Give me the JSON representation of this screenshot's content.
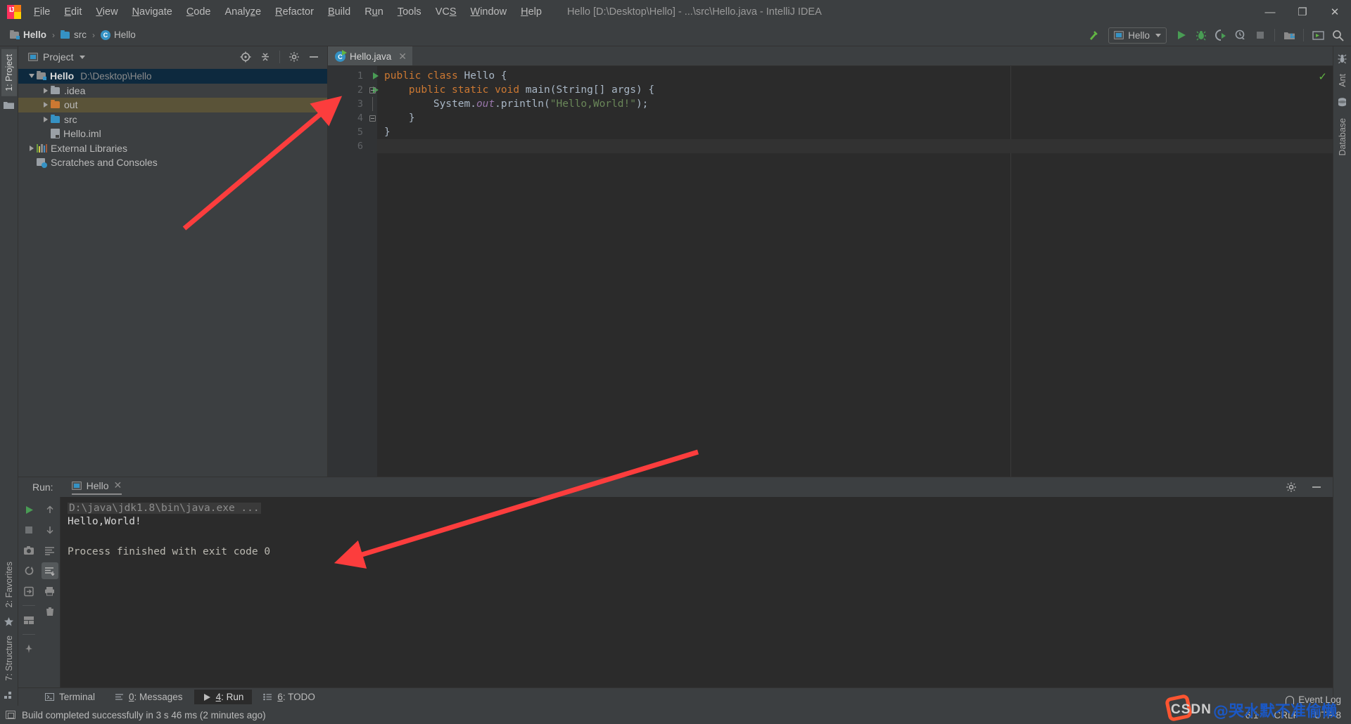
{
  "window": {
    "title": "Hello [D:\\Desktop\\Hello] - ...\\src\\Hello.java - IntelliJ IDEA",
    "minimize": "—",
    "maximize": "❐",
    "close": "✕"
  },
  "menu": [
    {
      "label": "File",
      "mnemonic": "F"
    },
    {
      "label": "Edit",
      "mnemonic": "E"
    },
    {
      "label": "View",
      "mnemonic": "V"
    },
    {
      "label": "Navigate",
      "mnemonic": "N"
    },
    {
      "label": "Code",
      "mnemonic": "C"
    },
    {
      "label": "Analyze",
      "mnemonic": "z"
    },
    {
      "label": "Refactor",
      "mnemonic": "R"
    },
    {
      "label": "Build",
      "mnemonic": "B"
    },
    {
      "label": "Run",
      "mnemonic": "u"
    },
    {
      "label": "Tools",
      "mnemonic": "T"
    },
    {
      "label": "VCS",
      "mnemonic": "S"
    },
    {
      "label": "Window",
      "mnemonic": "W"
    },
    {
      "label": "Help",
      "mnemonic": "H"
    }
  ],
  "breadcrumb": [
    {
      "label": "Hello",
      "icon": "module-icon"
    },
    {
      "label": "src",
      "icon": "folder-icon"
    },
    {
      "label": "Hello",
      "icon": "class-icon"
    }
  ],
  "toolbar": {
    "build_icon": "hammer-icon",
    "run_config": "Hello",
    "run_icon": "run-icon",
    "debug_icon": "debug-icon",
    "coverage_icon": "run-with-coverage-icon",
    "profile_icon": "profiler-icon",
    "stop_icon": "stop-icon",
    "structure_icon": "project-structure-icon",
    "layout_icon": "layout-icon",
    "search_icon": "search-everywhere-icon"
  },
  "left_sidebar": {
    "top": [
      {
        "label": "1: Project",
        "active": true
      }
    ],
    "bottom": [
      {
        "label": "2: Favorites",
        "active": false
      },
      {
        "label": "7: Structure",
        "active": false
      }
    ]
  },
  "right_sidebar": [
    {
      "label": "Ant",
      "icon": "ant-icon"
    },
    {
      "label": "Database",
      "icon": "database-icon"
    }
  ],
  "project_panel": {
    "title": "Project",
    "locate_icon": "locate-icon",
    "collapse_icon": "collapse-all-icon",
    "settings_icon": "gear-icon",
    "hide_icon": "hide-icon",
    "tree": [
      {
        "label": "Hello",
        "path": "D:\\Desktop\\Hello",
        "icon": "module-icon",
        "indent": 0,
        "arrow": "open",
        "state": "selected",
        "bold": true
      },
      {
        "label": ".idea",
        "path": "",
        "icon": "folder-grey-icon",
        "indent": 1,
        "arrow": "closed",
        "state": "",
        "bold": false
      },
      {
        "label": "out",
        "path": "",
        "icon": "folder-orange-icon",
        "indent": 1,
        "arrow": "closed",
        "state": "highlighted",
        "bold": false
      },
      {
        "label": "src",
        "path": "",
        "icon": "folder-blue-icon",
        "indent": 1,
        "arrow": "closed",
        "state": "",
        "bold": false
      },
      {
        "label": "Hello.iml",
        "path": "",
        "icon": "iml-file-icon",
        "indent": 1,
        "arrow": "none",
        "state": "",
        "bold": false
      },
      {
        "label": "External Libraries",
        "path": "",
        "icon": "libraries-icon",
        "indent": 0,
        "arrow": "closed",
        "state": "",
        "bold": false
      },
      {
        "label": "Scratches and Consoles",
        "path": "",
        "icon": "scratches-icon",
        "indent": 0,
        "arrow": "none",
        "state": "",
        "bold": false
      }
    ]
  },
  "editor": {
    "tab": {
      "label": "Hello.java",
      "icon": "java-class-icon",
      "close": "✕"
    },
    "inspection_ok": "✓",
    "lines": [
      {
        "n": "1",
        "indent": 0,
        "runmark": true,
        "tokens": [
          {
            "t": "public ",
            "c": "k"
          },
          {
            "t": "class ",
            "c": "k"
          },
          {
            "t": "Hello ",
            "c": "cls"
          },
          {
            "t": "{",
            "c": ""
          }
        ]
      },
      {
        "n": "2",
        "indent": 0,
        "runmark": true,
        "fold": "box",
        "tokens": [
          {
            "t": "    public ",
            "c": "k"
          },
          {
            "t": "static ",
            "c": "k"
          },
          {
            "t": "void ",
            "c": "k"
          },
          {
            "t": "main",
            "c": "cls"
          },
          {
            "t": "(",
            "c": ""
          },
          {
            "t": "String",
            "c": "cls"
          },
          {
            "t": "[] args) {",
            "c": ""
          }
        ]
      },
      {
        "n": "3",
        "indent": 0,
        "runmark": false,
        "fold": "line",
        "tokens": [
          {
            "t": "        System.",
            "c": ""
          },
          {
            "t": "out",
            "c": "fld"
          },
          {
            "t": ".println(",
            "c": ""
          },
          {
            "t": "\"Hello,World!\"",
            "c": "s"
          },
          {
            "t": ");",
            "c": ""
          }
        ]
      },
      {
        "n": "4",
        "indent": 0,
        "runmark": false,
        "fold": "box",
        "tokens": [
          {
            "t": "    }",
            "c": ""
          }
        ]
      },
      {
        "n": "5",
        "indent": 0,
        "runmark": false,
        "tokens": [
          {
            "t": "}",
            "c": ""
          }
        ]
      },
      {
        "n": "6",
        "indent": 0,
        "runmark": false,
        "tokens": [
          {
            "t": "",
            "c": ""
          }
        ]
      }
    ]
  },
  "run_panel": {
    "label": "Run:",
    "tab": {
      "label": "Hello",
      "icon": "run-config-icon",
      "close": "✕"
    },
    "settings_icon": "gear-icon",
    "hide_icon": "hide-icon",
    "left_tools": [
      "rerun-icon",
      "stop-icon",
      "dump-threads-icon",
      "restore-layout-icon",
      "export-icon",
      "layout-icon"
    ],
    "right_tools": [
      "scroll-up-icon",
      "scroll-down-icon",
      "soft-wrap-icon",
      "scroll-to-end-icon",
      "print-icon",
      "clear-all-icon"
    ],
    "console": {
      "command": "D:\\java\\jdk1.8\\bin\\java.exe ...",
      "output": "Hello,World!",
      "exit": "Process finished with exit code 0"
    }
  },
  "bottom_tabs": [
    {
      "label": "Terminal",
      "num": "",
      "icon": "terminal-icon",
      "active": false
    },
    {
      "label": "Messages",
      "num": "0",
      "icon": "messages-icon",
      "active": false
    },
    {
      "label": "Run",
      "num": "4",
      "icon": "run-icon",
      "active": true
    },
    {
      "label": "TODO",
      "num": "6",
      "icon": "todo-icon",
      "active": false
    }
  ],
  "status_bar": {
    "build_message": "Build completed successfully in 3 s 46 ms (2 minutes ago)",
    "caret_position": "6:1",
    "line_separator": "CRLF",
    "encoding": "UTF-8",
    "event_log": "Event Log"
  },
  "watermark": {
    "brand": "CSDN",
    "author": "@哭水默不准偷懒"
  },
  "colors": {
    "accent_green": "#499c54",
    "keyword_orange": "#cc7832",
    "string_green": "#6a8759",
    "field_purple": "#9876aa",
    "selection_blue": "#0d293e",
    "annotation_red": "#fc3d3d"
  }
}
